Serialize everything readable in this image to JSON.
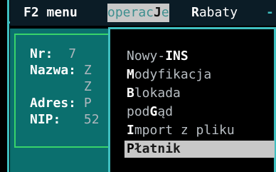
{
  "menubar": {
    "items": [
      {
        "prefix": "",
        "hotkey": "F2 menu",
        "suffix": ""
      },
      {
        "prefix": "operac",
        "hotkey": "J",
        "suffix": "e"
      },
      {
        "prefix": "",
        "hotkey": "R",
        "suffix": "abaty"
      }
    ],
    "trail": "-",
    "active_index": 1
  },
  "form": {
    "nr_label": "Nr:",
    "nr_value": "7",
    "nazwa_label": "Nazwa:",
    "nazwa_value_1": "Z",
    "nazwa_value_2": "Z",
    "adres_label": "Adres:",
    "adres_value": "P",
    "nip_label": "NIP:",
    "nip_value": "52"
  },
  "dropdown": {
    "items": [
      {
        "prefix": "Nowy-",
        "hotkey": "INS",
        "suffix": ""
      },
      {
        "prefix": "",
        "hotkey": "M",
        "suffix": "odyfikacja"
      },
      {
        "prefix": "",
        "hotkey": "B",
        "suffix": "lokada"
      },
      {
        "prefix": "pod",
        "hotkey": "G",
        "suffix": "ąd"
      },
      {
        "prefix": "",
        "hotkey": "I",
        "suffix": "mport z pliku"
      },
      {
        "prefix": "",
        "hotkey": "P",
        "suffix": "łatnik"
      }
    ],
    "selected_index": 5
  },
  "colors": {
    "frame": "#3fbfc0",
    "card": "#0b6f6e",
    "card_border": "#38d46a",
    "highlight": "#c8c8c8"
  }
}
